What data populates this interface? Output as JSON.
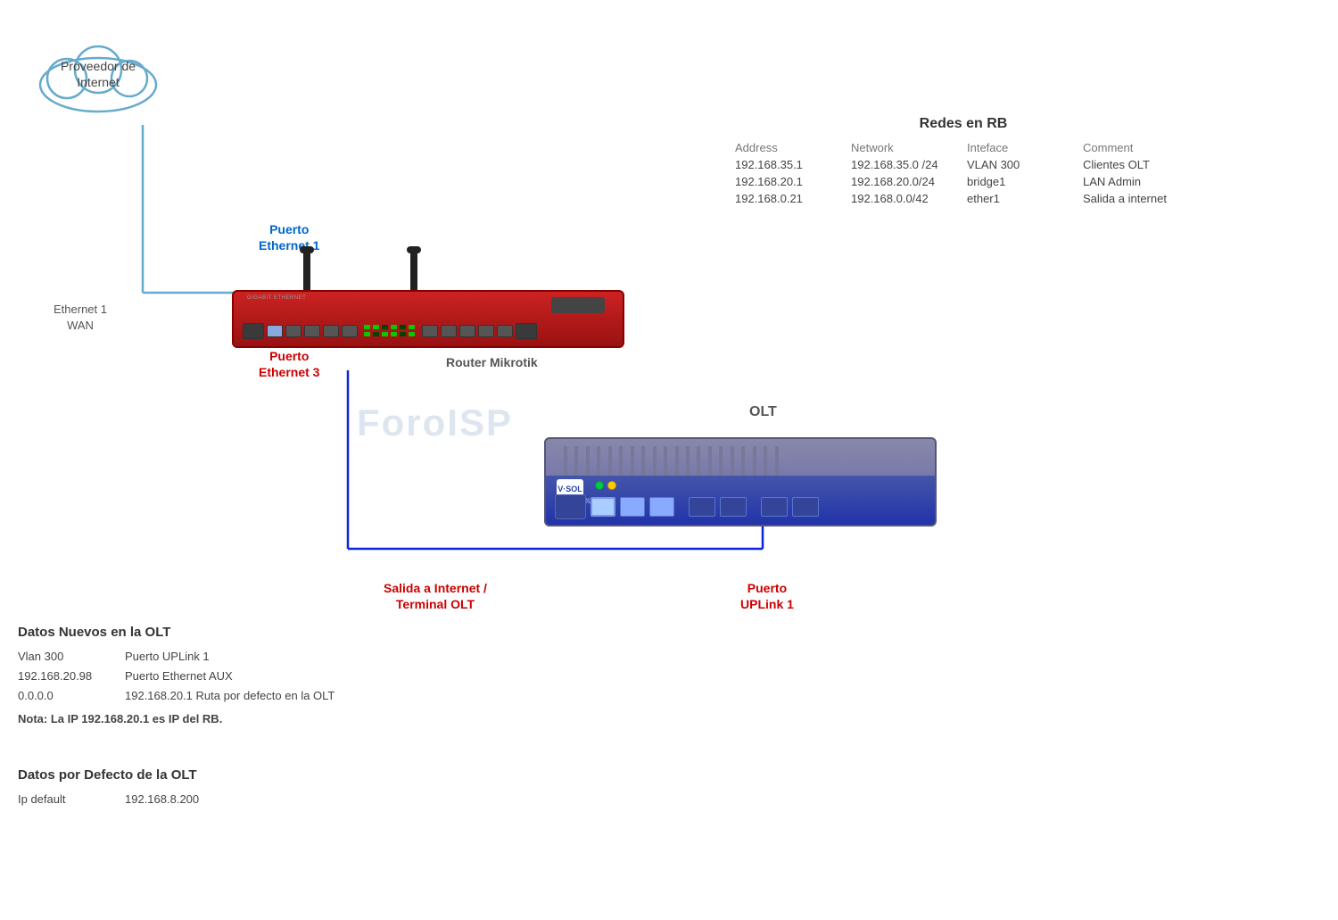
{
  "cloud": {
    "label_line1": "Proveedor de",
    "label_line2": "Internet"
  },
  "redes": {
    "title": "Redes en RB",
    "headers": [
      "Address",
      "Network",
      "Inteface",
      "Comment"
    ],
    "rows": [
      [
        "192.168.35.1",
        "192.168.35.0 /24",
        "VLAN 300",
        "Clientes OLT"
      ],
      [
        "192.168.20.1",
        "192.168.20.0/24",
        "bridge1",
        "LAN Admin"
      ],
      [
        "192.168.0.21",
        "192.168.0.0/42",
        "ether1",
        "Salida a internet"
      ]
    ]
  },
  "labels": {
    "ethernet1": "Puerto\nEthernet 1",
    "ethernet1_line1": "Puerto",
    "ethernet1_line2": "Ethernet 1",
    "ethernet3_line1": "Puerto",
    "ethernet3_line2": "Ethernet 3",
    "wan_line1": "Ethernet 1",
    "wan_line2": "WAN",
    "router": "Router Mikrotik",
    "olt": "OLT",
    "salida_line1": "Salida a Internet /",
    "salida_line2": "Terminal  OLT",
    "uplink_line1": "Puerto",
    "uplink_line2": "UPLink 1"
  },
  "datos_nuevos": {
    "title": "Datos Nuevos en  la OLT",
    "row1_col1": "Vlan 300",
    "row1_col2": "Puerto UPLink 1",
    "row2_col1": "192.168.20.98",
    "row2_col2": "Puerto Ethernet AUX",
    "row3_col1": "0.0.0.0",
    "row3_col2": "192.168.20.1    Ruta  por defecto en la OLT",
    "nota": "Nota: La IP 192.168.20.1 es IP del RB."
  },
  "datos_defecto": {
    "title": "Datos por Defecto de la OLT",
    "row1_col1": "Ip default",
    "row1_col2": "192.168.8.200"
  },
  "watermark": "ForoISP"
}
